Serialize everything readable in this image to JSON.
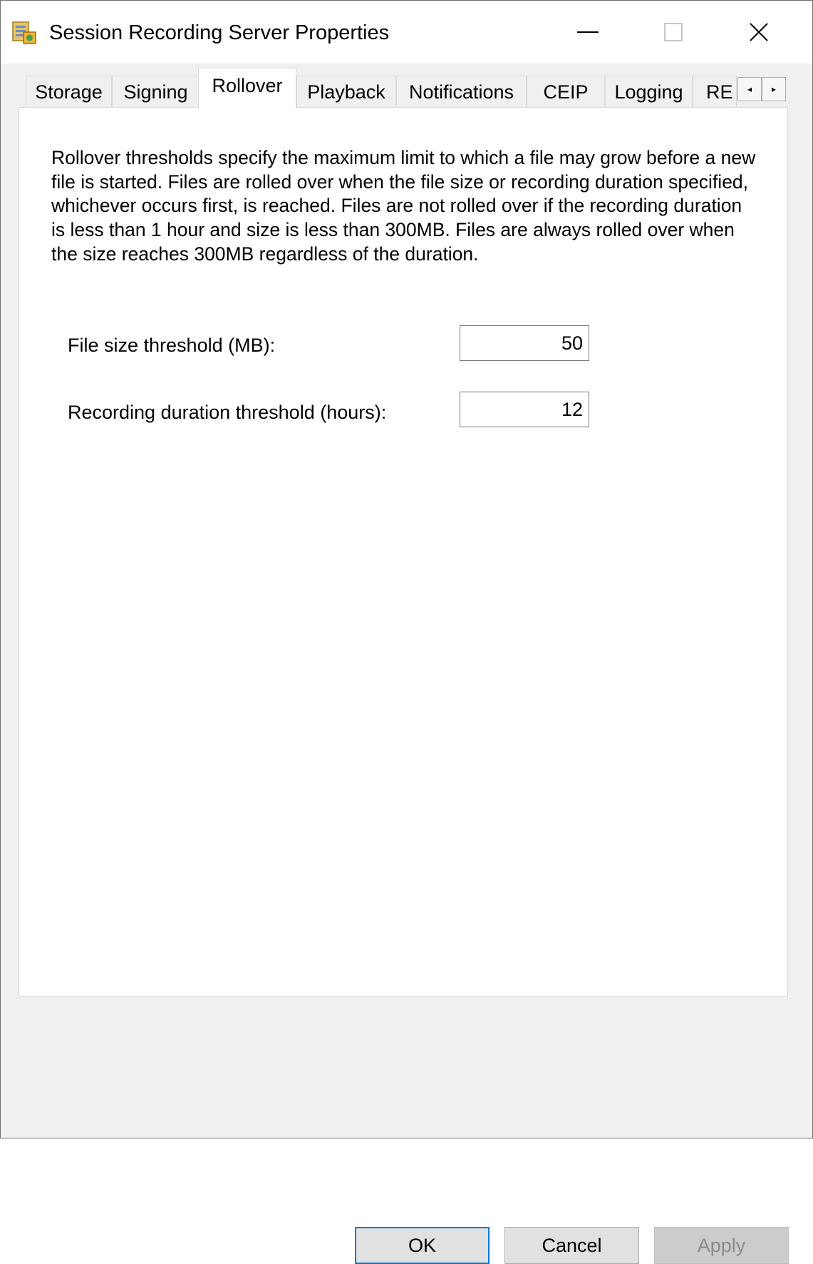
{
  "window": {
    "title": "Session Recording Server Properties",
    "app_icon": "server-properties-icon",
    "controls": {
      "minimize_icon": "minimize-icon",
      "maximize_icon": "maximize-icon",
      "close_icon": "close-icon",
      "close_glyph": "✕"
    }
  },
  "tabs": [
    {
      "label": "Storage",
      "active": false
    },
    {
      "label": "Signing",
      "active": false
    },
    {
      "label": "Rollover",
      "active": true
    },
    {
      "label": "Playback",
      "active": false
    },
    {
      "label": "Notifications",
      "active": false
    },
    {
      "label": "CEIP",
      "active": false
    },
    {
      "label": "Logging",
      "active": false
    },
    {
      "label": "RE",
      "active": false
    }
  ],
  "tab_scroll": {
    "left_glyph": "◂",
    "right_glyph": "▸"
  },
  "rollover": {
    "description": "Rollover thresholds specify the maximum limit to which a file may grow before a new file is started. Files are rolled over when the file size or recording duration specified, whichever occurs first, is reached. Files are not rolled over if the recording duration is less than 1 hour and size is less than 300MB. Files are always rolled over when the size reaches 300MB regardless of the duration.",
    "file_size_label": "File size threshold (MB):",
    "file_size_value": "50",
    "duration_label": "Recording duration threshold (hours):",
    "duration_value": "12"
  },
  "buttons": {
    "ok": "OK",
    "cancel": "Cancel",
    "apply": "Apply",
    "apply_enabled": false
  },
  "colors": {
    "focus_border": "#0078d7",
    "button_face": "#e1e1e1",
    "disabled_text": "#8a8a8a"
  }
}
